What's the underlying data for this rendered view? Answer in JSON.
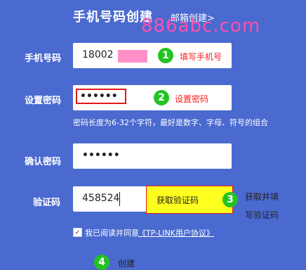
{
  "header": {
    "title": "手机号码创建",
    "link": "邮箱创建>"
  },
  "watermark": "886abc.com",
  "phone": {
    "label": "手机号码",
    "value": "18002",
    "step": "1",
    "hint": "填写手机号",
    "mask_color": "#ff8fc9"
  },
  "password": {
    "label": "设置密码",
    "value": "••••••",
    "step": "2",
    "hint": "设置密码",
    "note": "密码长度为6-32个字符，最好是数字、字母、符号的组合"
  },
  "confirm": {
    "label": "确认密码",
    "value": "••••••"
  },
  "code": {
    "label": "验证码",
    "value": "458524",
    "button": "获取验证码",
    "step": "3",
    "hint_line1": "获取并填",
    "hint_line2": "写验证码"
  },
  "agreement": {
    "text": "我已阅读并同意",
    "link": "《TP-LINK用户协议》",
    "checked": true
  },
  "footer": {
    "step": "4",
    "text": "创建"
  },
  "colors": {
    "background": "#4a6ad0",
    "step_badge": "#22c322",
    "hint": "#ff1a1a",
    "button": "#ffff1f"
  }
}
